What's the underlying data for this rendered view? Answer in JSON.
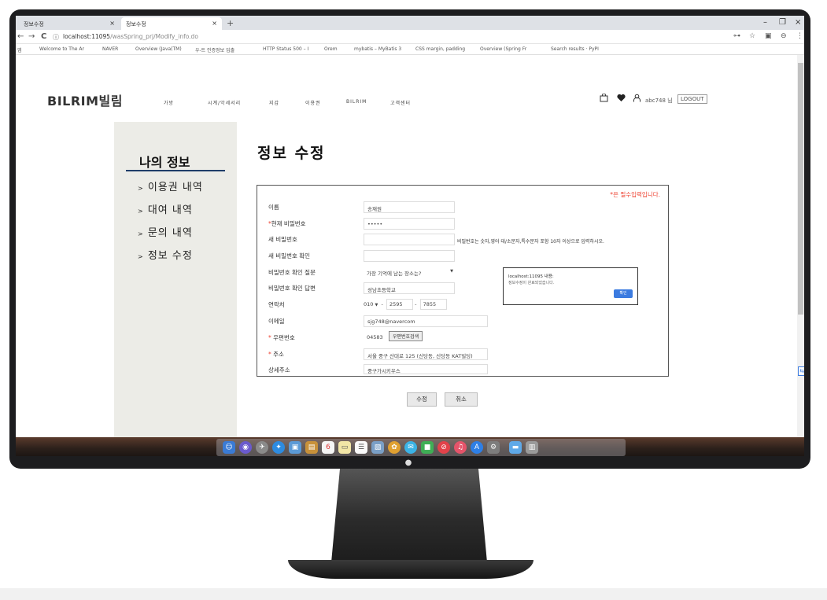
{
  "browser": {
    "tabs": [
      {
        "label": "정보수정",
        "close": "×"
      },
      {
        "label": "정보수정",
        "close": "×"
      }
    ],
    "new_tab": "+",
    "window_controls": [
      "–",
      "❐",
      "×"
    ],
    "nav": {
      "back": "←",
      "forward": "→",
      "reload": "C",
      "info": "ⓘ"
    },
    "url_host": "localhost:11095",
    "url_path": "/wasSpring_prj/Modify_info.do",
    "addr_icons": [
      "⊶",
      "☆",
      "▣",
      "⊖",
      "⋮"
    ],
    "bookmarks": [
      "앱",
      "Welcome to The Ar",
      "NAVER",
      "Overview (Java(TM)",
      "우-트 인증정보 입출",
      "HTTP Status 500 – I",
      "Orem",
      "mybatis – MyBatis 3",
      "CSS margin, padding",
      "Overview (Spring Fr",
      "Search results · PyPI"
    ]
  },
  "header": {
    "logo": "BILRIM빌림",
    "nav": [
      "가방",
      "시계/악세서리",
      "지갑",
      "이용권",
      "BILRIM",
      "고객센터"
    ],
    "icons": [
      "bag-icon",
      "heart-icon",
      "user-icon"
    ],
    "user_text": "abc748 님",
    "logout": "LOGOUT"
  },
  "sidebar": {
    "title": "나의 정보",
    "items": [
      {
        "label": "이용권 내역"
      },
      {
        "label": "대여 내역"
      },
      {
        "label": "문의 내역"
      },
      {
        "label": "정보 수정"
      }
    ],
    "bullet": ">"
  },
  "main": {
    "title": "정보 수정",
    "required_note": "*은 필수입력입니다.",
    "rows": [
      {
        "label": "이름",
        "required": false,
        "value": "송재원"
      },
      {
        "label": "현재 비밀번호",
        "required": true,
        "value": "•••••"
      },
      {
        "label": "새 비밀번호",
        "required": false,
        "value": ""
      },
      {
        "label": "새 비밀번호 확인",
        "required": false,
        "value": ""
      },
      {
        "label": "비밀번호 확인 질문",
        "required": false,
        "value": "가장 기억에 남는 장소는?"
      },
      {
        "label": "비밀번호 확인 답변",
        "required": false,
        "value": "성남초등학교"
      },
      {
        "label": "연락처",
        "required": false,
        "value": ""
      },
      {
        "label": "이메일",
        "required": false,
        "value": "sjg748@navercom"
      },
      {
        "label": "우편번호",
        "required": true,
        "value": "04583"
      },
      {
        "label": "주소",
        "required": true,
        "value": "서울 중구 산대로 125 (신당동, 신당동 KAT빌딩)"
      },
      {
        "label": "상세주소",
        "required": false,
        "value": "중구가시키우스"
      }
    ],
    "password_hint": "비밀번호는 숫자,영어 대/소문자,특수문자 포함 10자 이상으로 입력하시오.",
    "select_arrow": "▼",
    "phone": {
      "first": "010",
      "mid": "2595",
      "last": "7855",
      "dash": "-"
    },
    "zip_button": "우편번호검색",
    "submit": "수정",
    "cancel": "취소"
  },
  "dialog": {
    "title": "localhost:11095 내용:",
    "message": "정보수정이 완료되었습니다.",
    "ok": "확인"
  },
  "dock": {
    "icons": [
      "finder-icon",
      "siri-icon",
      "launchpad-icon",
      "safari-icon",
      "photos-icon",
      "notes-icon",
      "calendar-icon",
      "stickies-icon",
      "reminders-icon",
      "preview-icon",
      "photo-booth-icon",
      "messages-icon",
      "facetime-icon",
      "news-icon",
      "music-icon",
      "app-store-icon",
      "system-preferences-icon",
      "folder-icon",
      "trash-icon"
    ],
    "calendar_day": "6"
  },
  "colors": {
    "accent": "#1f3e6a",
    "required": "#ee4433",
    "sidebar_bg": "#ecece7",
    "dialog_button": "#3b7be0"
  }
}
